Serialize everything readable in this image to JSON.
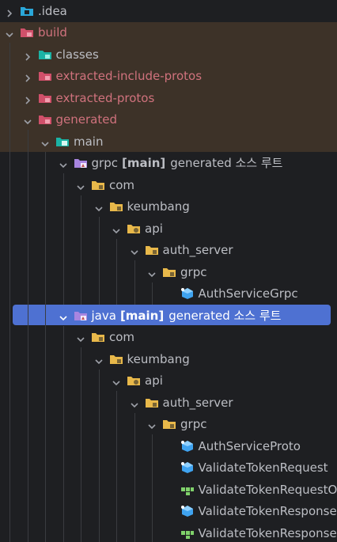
{
  "tree": {
    "items": [
      {
        "label": ".idea",
        "icon": "idea-folder-icon",
        "expanded": false
      },
      {
        "label": "build",
        "icon": "excluded-folder-icon",
        "expanded": true
      },
      {
        "label": "classes",
        "icon": "teal-folder-icon",
        "expanded": false
      },
      {
        "label": "extracted-include-protos",
        "icon": "excluded-folder-icon",
        "expanded": false
      },
      {
        "label": "extracted-protos",
        "icon": "excluded-folder-icon",
        "expanded": false
      },
      {
        "label": "generated",
        "icon": "excluded-folder-icon",
        "expanded": true
      },
      {
        "label": "main",
        "icon": "teal-module-folder-icon",
        "expanded": true
      },
      {
        "label": "grpc",
        "tag": "[main]",
        "suffix": "generated 소스 루트",
        "icon": "generated-source-root-icon",
        "expanded": true
      },
      {
        "label": "com",
        "icon": "package-folder-icon",
        "expanded": true
      },
      {
        "label": "keumbang",
        "icon": "package-folder-icon",
        "expanded": true
      },
      {
        "label": "api",
        "icon": "api-package-icon",
        "expanded": true
      },
      {
        "label": "auth_server",
        "icon": "package-folder-icon",
        "expanded": true
      },
      {
        "label": "grpc",
        "icon": "package-folder-icon",
        "expanded": true
      },
      {
        "label": "AuthServiceGrpc",
        "icon": "generated-class-icon"
      },
      {
        "label": "java",
        "tag": "[main]",
        "suffix": "generated 소스 루트",
        "icon": "generated-source-root-icon",
        "expanded": true
      },
      {
        "label": "com",
        "icon": "package-folder-icon",
        "expanded": true
      },
      {
        "label": "keumbang",
        "icon": "package-folder-icon",
        "expanded": true
      },
      {
        "label": "api",
        "icon": "api-package-icon",
        "expanded": true
      },
      {
        "label": "auth_server",
        "icon": "package-folder-icon",
        "expanded": true
      },
      {
        "label": "grpc",
        "icon": "package-folder-icon",
        "expanded": true
      },
      {
        "label": "AuthServiceProto",
        "icon": "generated-class-icon"
      },
      {
        "label": "ValidateTokenRequest",
        "icon": "generated-class-icon"
      },
      {
        "label": "ValidateTokenRequestOrBuilder",
        "icon": "interface-icon"
      },
      {
        "label": "ValidateTokenResponse",
        "icon": "generated-class-icon"
      },
      {
        "label": "ValidateTokenResponseOrBuilder",
        "icon": "interface-icon"
      }
    ]
  },
  "colors": {
    "background": "#1e1f22",
    "excluded_band": "#3d3228",
    "selection": "#4e71d2",
    "text": "#bcbec4",
    "excluded_text": "#d0727d",
    "folder_yellow": "#e8b84a",
    "folder_teal": "#1bb3a5",
    "folder_excluded": "#d0506a",
    "source_root_purple": "#a885e0"
  }
}
